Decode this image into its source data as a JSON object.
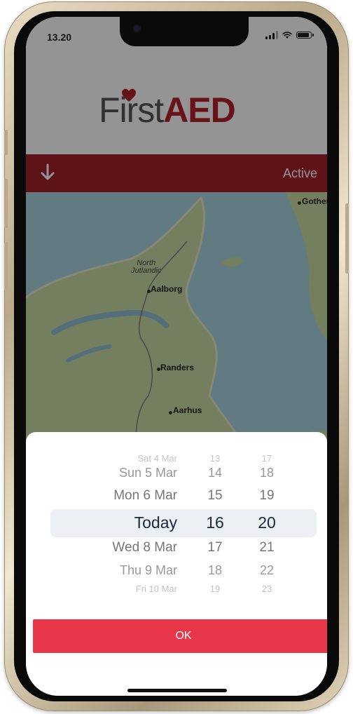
{
  "status_bar": {
    "time": "13.20"
  },
  "header": {
    "logo_first": "First",
    "logo_aed": "AED"
  },
  "toolbar": {
    "status_label": "Active"
  },
  "map": {
    "labels": {
      "gothenburg": "Gothen",
      "region_line1": "North",
      "region_line2": "Jutlandic",
      "aalborg": "Aalborg",
      "randers": "Randers",
      "aarhus": "Aarhus"
    }
  },
  "picker": {
    "rows": [
      {
        "date": "Sat 4 Mar",
        "hour": "13",
        "minute": "17"
      },
      {
        "date": "Sun 5 Mar",
        "hour": "14",
        "minute": "18"
      },
      {
        "date": "Mon 6 Mar",
        "hour": "15",
        "minute": "19"
      },
      {
        "date": "Today",
        "hour": "16",
        "minute": "20"
      },
      {
        "date": "Wed 8 Mar",
        "hour": "17",
        "minute": "21"
      },
      {
        "date": "Thu 9 Mar",
        "hour": "18",
        "minute": "22"
      },
      {
        "date": "Fri 10 Mar",
        "hour": "19",
        "minute": "23"
      }
    ]
  },
  "ok_button": {
    "label": "OK"
  },
  "colors": {
    "brand_red": "#a3222b",
    "ok_red": "#e8364a"
  }
}
